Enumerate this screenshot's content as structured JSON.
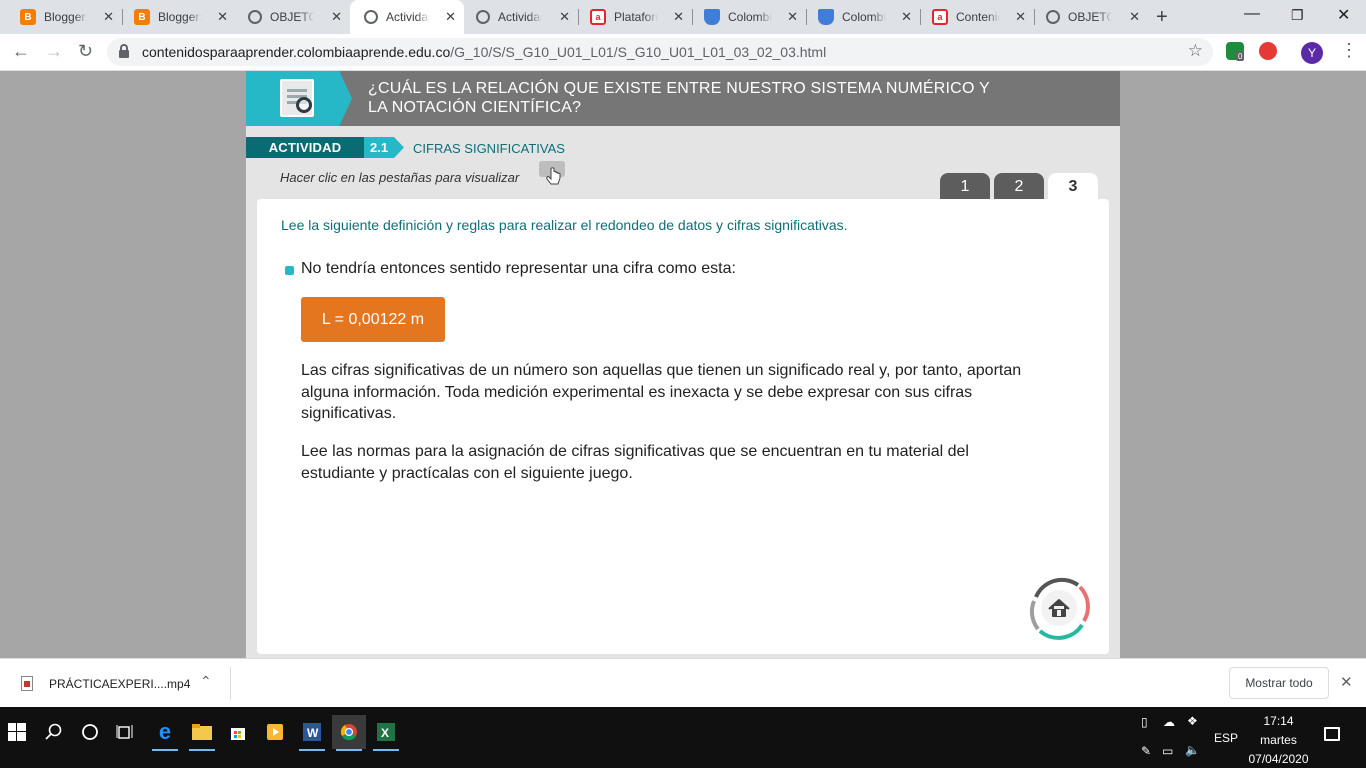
{
  "browser": {
    "tabs": [
      {
        "title": "Blogger: ",
        "icon": "blogger-icon",
        "active": false
      },
      {
        "title": "Blogger: ",
        "icon": "blogger-icon",
        "active": false
      },
      {
        "title": "OBJETO D",
        "icon": "globe-icon",
        "active": false
      },
      {
        "title": "Actividad",
        "icon": "globe-icon",
        "active": true
      },
      {
        "title": "Actividad",
        "icon": "globe-icon",
        "active": false
      },
      {
        "title": "Plataform",
        "icon": "colombia-aprende-icon",
        "active": false
      },
      {
        "title": "Colombia",
        "icon": "shield-icon",
        "active": false
      },
      {
        "title": "Colombia",
        "icon": "shield-icon",
        "active": false
      },
      {
        "title": "Contenid",
        "icon": "colombia-aprende-icon",
        "active": false
      },
      {
        "title": "OBJETO D",
        "icon": "globe-icon",
        "active": false
      }
    ],
    "url_host": "contenidosparaaprender.colombiaaprende.edu.co",
    "url_path": "/G_10/S/S_G10_U01_L01/S_G10_U01_L01_03_02_03.html",
    "profile_initial": "Y",
    "extension_badge": "0"
  },
  "page": {
    "header_title": "¿CUÁL ES LA RELACIÓN QUE EXISTE ENTRE NUESTRO SISTEMA NUMÉRICO Y LA NOTACIÓN CIENTÍFICA?",
    "activity_label": "ACTIVIDAD",
    "activity_number": "2.1",
    "activity_subtitle": "CIFRAS SIGNIFICATIVAS",
    "hint": "Hacer clic en las pestañas para visualizar",
    "tabs": [
      "1",
      "2",
      "3"
    ],
    "active_tab": "3",
    "intro": "Lee la siguiente definición y reglas para realizar el redondeo de datos y cifras significativas.",
    "bullet": "No tendría entonces sentido representar una cifra como esta:",
    "formula": "L = 0,00122 m",
    "paragraph_1": "Las cifras significativas de un número son aquellas que tienen un significado real y, por tanto, aportan alguna información. Toda medición experimental es inexacta y se debe expresar con sus cifras significativas.",
    "paragraph_2": "Lee las normas para la asignación de cifras significativas que se encuentran en tu material del estudiante y practícalas con el siguiente juego.",
    "colors": {
      "teal": "#26b8c6",
      "dark_teal": "#0b6b73",
      "orange": "#e3761e",
      "header_gray": "#767676"
    }
  },
  "download_bar": {
    "file_name": "PRÁCTICAEXPERI....mp4",
    "show_all": "Mostrar todo"
  },
  "taskbar": {
    "language": "ESP",
    "time": "17:14",
    "day": "martes",
    "date": "07/04/2020"
  }
}
